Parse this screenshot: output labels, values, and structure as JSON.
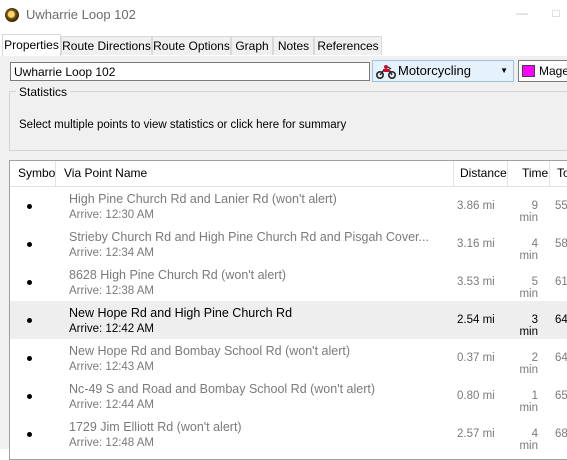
{
  "window": {
    "title": "Uwharrie Loop 102",
    "controls": [
      "—",
      "□"
    ]
  },
  "tabs": [
    {
      "label": "Properties",
      "active": true
    },
    {
      "label": "Route Directions",
      "active": false
    },
    {
      "label": "Route Options",
      "active": false
    },
    {
      "label": "Graph",
      "active": false
    },
    {
      "label": "Notes",
      "active": false
    },
    {
      "label": "References",
      "active": false
    }
  ],
  "properties": {
    "name_value": "Uwharrie Loop 102",
    "mode": {
      "label": "Motorcycling",
      "icon": "motorcycle-icon"
    },
    "color": {
      "label": "Magenta",
      "hex": "#ff00ff"
    }
  },
  "statistics": {
    "legend": "Statistics",
    "message": "Select multiple points to view statistics or click here for summary"
  },
  "table": {
    "columns": [
      "Symbol",
      "Via Point Name",
      "Distance",
      "Time",
      "To"
    ],
    "rows": [
      {
        "name": "High Pine Church Rd and Lanier Rd (won't alert)",
        "arrive": "Arrive: 12:30 AM",
        "distance": "3.86 mi",
        "time": "9 min",
        "total": "55",
        "selected": false
      },
      {
        "name": "Strieby Church Rd and High Pine Church Rd and Pisgah Cover...",
        "arrive": "Arrive: 12:34 AM",
        "distance": "3.16 mi",
        "time": "4 min",
        "total": "58",
        "selected": false
      },
      {
        "name": "8628 High Pine Church Rd (won't alert)",
        "arrive": "Arrive: 12:38 AM",
        "distance": "3.53 mi",
        "time": "5 min",
        "total": "61",
        "selected": false
      },
      {
        "name": "New Hope Rd and High Pine Church Rd",
        "arrive": "Arrive: 12:42 AM",
        "distance": "2.54 mi",
        "time": "3 min",
        "total": "64",
        "selected": true
      },
      {
        "name": "New Hope Rd and Bombay School Rd (won't alert)",
        "arrive": "Arrive: 12:43 AM",
        "distance": "0.37 mi",
        "time": "2 min",
        "total": "64",
        "selected": false
      },
      {
        "name": "Nc-49 S and Road and Bombay School Rd (won't alert)",
        "arrive": "Arrive: 12:44 AM",
        "distance": "0.80 mi",
        "time": "1 min",
        "total": "65",
        "selected": false
      },
      {
        "name": "1729 Jim Elliott Rd (won't alert)",
        "arrive": "Arrive: 12:48 AM",
        "distance": "2.57 mi",
        "time": "4 min",
        "total": "68",
        "selected": false
      }
    ]
  }
}
